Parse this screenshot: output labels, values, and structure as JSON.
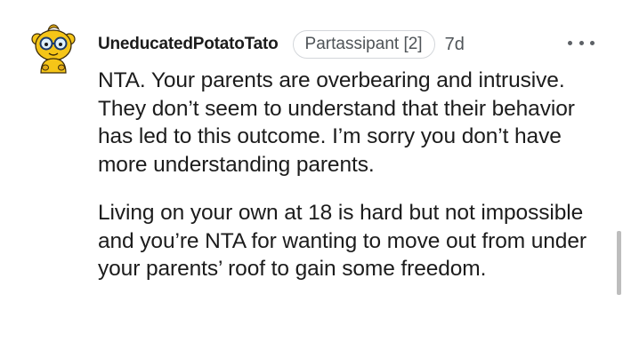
{
  "comment": {
    "username": "UneducatedPotatoTato",
    "flair": "Partassipant [2]",
    "age": "7d",
    "more_icon": "more-horizontal-icon",
    "paragraphs": [
      "NTA. Your parents are overbearing and intrusive. They don’t seem to understand that their behavior has led to this outcome. I’m sorry you don’t have more understanding parents.",
      "Living on your own at 18 is hard but not impossible and you’re NTA for wanting to move out from under your parents’ roof to gain some freedom."
    ]
  },
  "colors": {
    "text": "#1c1c1c",
    "meta": "#4f5458",
    "flair_border": "#d3d6da",
    "avatar_yellow": "#f5c518",
    "scrollbar": "#bdbdbd"
  }
}
